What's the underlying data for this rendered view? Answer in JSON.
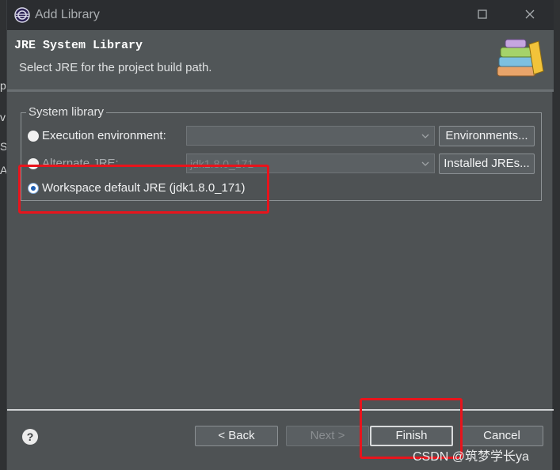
{
  "window": {
    "title": "Add Library"
  },
  "header": {
    "title": "JRE System Library",
    "subtitle": "Select JRE for the project build path."
  },
  "group": {
    "label": "System library",
    "options": [
      {
        "label": "Execution environment:",
        "checked": false,
        "enabled": true,
        "combo_value": "",
        "button": "Environments..."
      },
      {
        "label": "Alternate JRE:",
        "checked": false,
        "enabled": false,
        "combo_value": "jdk1.8.0_171",
        "button": "Installed JREs..."
      },
      {
        "label": "Workspace default JRE (jdk1.8.0_171)",
        "checked": true,
        "enabled": true
      }
    ]
  },
  "footer": {
    "back": "< Back",
    "next": "Next >",
    "finish": "Finish",
    "cancel": "Cancel"
  },
  "watermark": "CSDN @筑梦学长ya",
  "colors": {
    "highlight": "#e8141c",
    "radio_selected": "#1e5fb4"
  }
}
